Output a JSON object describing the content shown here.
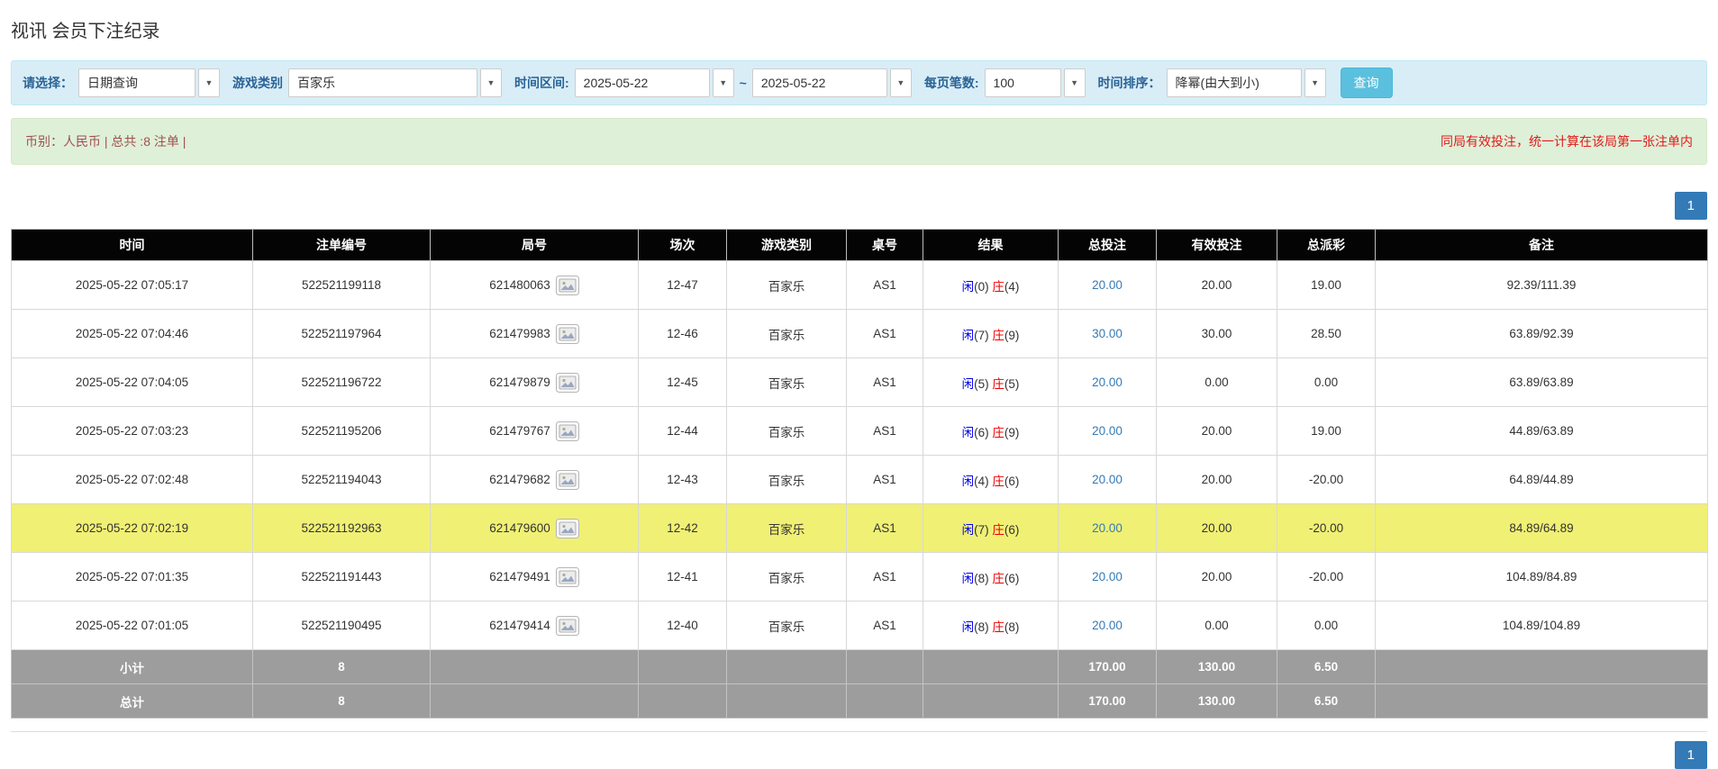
{
  "page": {
    "title": "视讯 会员下注纪录"
  },
  "filters": {
    "query_type_label": "请选择：",
    "query_type_value": "日期查询",
    "game_type_label": "游戏类别",
    "game_type_value": "百家乐",
    "time_range_label": "时间区间:",
    "date_from": "2025-05-22",
    "range_separator": "~",
    "date_to": "2025-05-22",
    "page_size_label": "每页笔数:",
    "page_size_value": "100",
    "sort_label": "时间排序：",
    "sort_value": "降幂(由大到小)",
    "query_button_label": "查询"
  },
  "summary": {
    "left_text": "币别：人民币 | 总共 :8 注单 |",
    "right_text": "同局有效投注，统一计算在该局第一张注单内"
  },
  "pagination": {
    "current_page": "1"
  },
  "table": {
    "headers": [
      "时间",
      "注单编号",
      "局号",
      "场次",
      "游戏类别",
      "桌号",
      "结果",
      "总投注",
      "有效投注",
      "总派彩",
      "备注"
    ],
    "rows": [
      {
        "time": "2025-05-22 07:05:17",
        "bet_id": "522521199118",
        "round_no": "621480063",
        "session": "12-47",
        "game_type": "百家乐",
        "table_no": "AS1",
        "result_player": "闲(0)",
        "result_banker": "庄(4)",
        "total_bet": "20.00",
        "valid_bet": "20.00",
        "payout": "19.00",
        "note": "92.39/111.39",
        "highlight": false
      },
      {
        "time": "2025-05-22 07:04:46",
        "bet_id": "522521197964",
        "round_no": "621479983",
        "session": "12-46",
        "game_type": "百家乐",
        "table_no": "AS1",
        "result_player": "闲(7)",
        "result_banker": "庄(9)",
        "total_bet": "30.00",
        "valid_bet": "30.00",
        "payout": "28.50",
        "note": "63.89/92.39",
        "highlight": false
      },
      {
        "time": "2025-05-22 07:04:05",
        "bet_id": "522521196722",
        "round_no": "621479879",
        "session": "12-45",
        "game_type": "百家乐",
        "table_no": "AS1",
        "result_player": "闲(5)",
        "result_banker": "庄(5)",
        "total_bet": "20.00",
        "valid_bet": "0.00",
        "payout": "0.00",
        "note": "63.89/63.89",
        "highlight": false
      },
      {
        "time": "2025-05-22 07:03:23",
        "bet_id": "522521195206",
        "round_no": "621479767",
        "session": "12-44",
        "game_type": "百家乐",
        "table_no": "AS1",
        "result_player": "闲(6)",
        "result_banker": "庄(9)",
        "total_bet": "20.00",
        "valid_bet": "20.00",
        "payout": "19.00",
        "note": "44.89/63.89",
        "highlight": false
      },
      {
        "time": "2025-05-22 07:02:48",
        "bet_id": "522521194043",
        "round_no": "621479682",
        "session": "12-43",
        "game_type": "百家乐",
        "table_no": "AS1",
        "result_player": "闲(4)",
        "result_banker": "庄(6)",
        "total_bet": "20.00",
        "valid_bet": "20.00",
        "payout": "-20.00",
        "note": "64.89/44.89",
        "highlight": false
      },
      {
        "time": "2025-05-22 07:02:19",
        "bet_id": "522521192963",
        "round_no": "621479600",
        "session": "12-42",
        "game_type": "百家乐",
        "table_no": "AS1",
        "result_player": "闲(7)",
        "result_banker": "庄(6)",
        "total_bet": "20.00",
        "valid_bet": "20.00",
        "payout": "-20.00",
        "note": "84.89/64.89",
        "highlight": true
      },
      {
        "time": "2025-05-22 07:01:35",
        "bet_id": "522521191443",
        "round_no": "621479491",
        "session": "12-41",
        "game_type": "百家乐",
        "table_no": "AS1",
        "result_player": "闲(8)",
        "result_banker": "庄(6)",
        "total_bet": "20.00",
        "valid_bet": "20.00",
        "payout": "-20.00",
        "note": "104.89/84.89",
        "highlight": false
      },
      {
        "time": "2025-05-22 07:01:05",
        "bet_id": "522521190495",
        "round_no": "621479414",
        "session": "12-40",
        "game_type": "百家乐",
        "table_no": "AS1",
        "result_player": "闲(8)",
        "result_banker": "庄(8)",
        "total_bet": "20.00",
        "valid_bet": "0.00",
        "payout": "0.00",
        "note": "104.89/104.89",
        "highlight": false
      }
    ],
    "subtotal": {
      "label": "小计",
      "count": "8",
      "total_bet": "170.00",
      "valid_bet": "130.00",
      "payout": "6.50"
    },
    "total": {
      "label": "总计",
      "count": "8",
      "total_bet": "170.00",
      "valid_bet": "130.00",
      "payout": "6.50"
    }
  },
  "icons": {
    "dropdown_arrow": "▼",
    "roadmap_icon": "roadmap-thumbnail"
  },
  "colors": {
    "accent_blue": "#337ab7",
    "query_button_blue": "#5bc0de",
    "filter_bar_bg": "#d9edf7",
    "summary_bar_bg": "#dff0d8",
    "highlight_row_yellow": "#f0f075",
    "player_blue": "#0000ee",
    "banker_red": "#ee0000",
    "negative_red": "#e01b1b",
    "header_bg": "#040404",
    "footer_gray": "#9d9d9d"
  }
}
